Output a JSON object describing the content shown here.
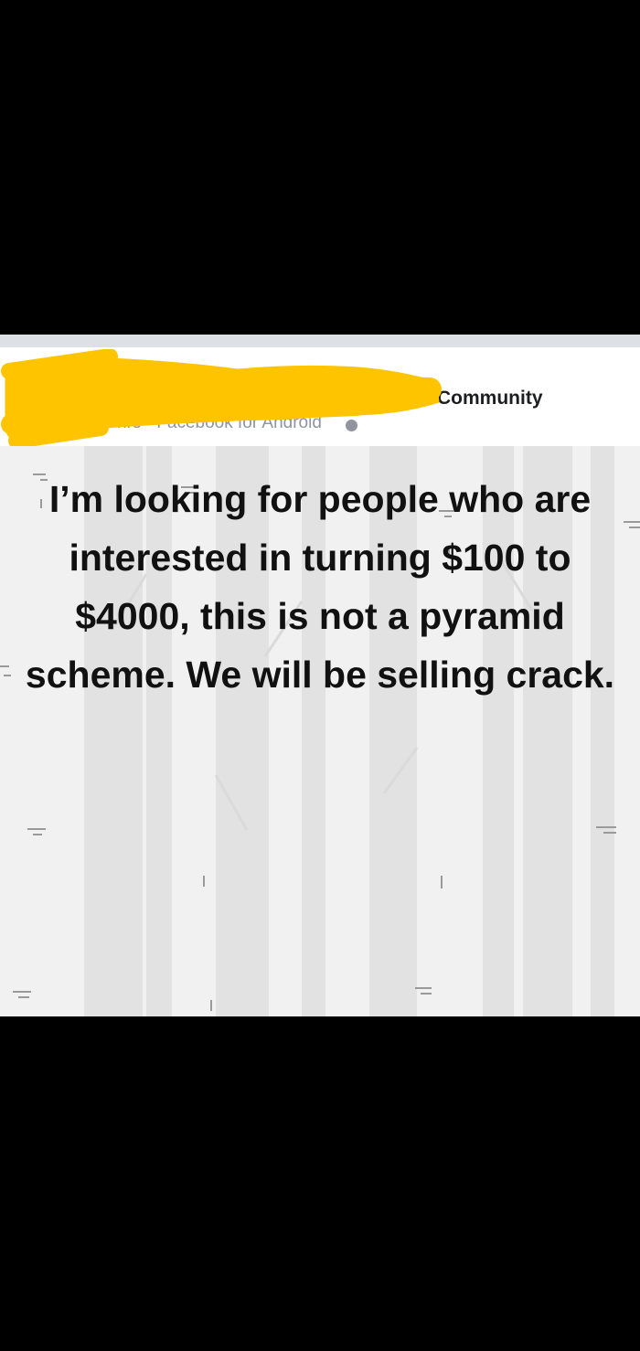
{
  "post": {
    "group_name_visible": "Community",
    "meta_time": "hrs",
    "meta_separator": "·",
    "meta_source": "Facebook for Android",
    "privacy_icon": "globe-icon",
    "redaction_color": "#FFC400",
    "body_text": "I’m looking for people who are interested in turning $100 to $4000, this is not a pyramid scheme. We will be selling crack.",
    "background_colors": {
      "panel": "#F1F1F1",
      "trunks": "#E2E2E2",
      "text": "#111111"
    }
  }
}
